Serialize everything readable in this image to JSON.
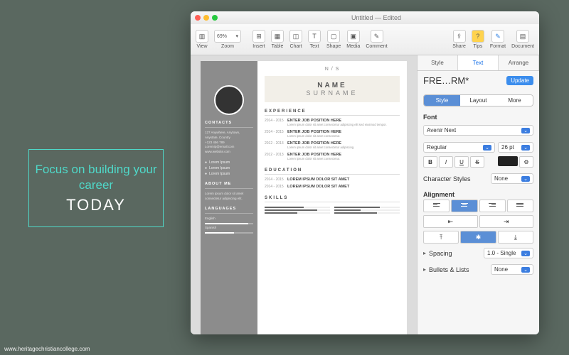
{
  "promo": {
    "line1": "Focus on building your career",
    "line2": "TODAY"
  },
  "watermark": "www.heritagechristiancollege.com",
  "window": {
    "title": "Untitled — Edited"
  },
  "toolbar": {
    "view": "View",
    "zoom": "Zoom",
    "zoom_value": "69%",
    "insert": "Insert",
    "table": "Table",
    "chart": "Chart",
    "text": "Text",
    "shape": "Shape",
    "media": "Media",
    "comment": "Comment",
    "share": "Share",
    "tips": "Tips",
    "format": "Format",
    "document": "Document"
  },
  "inspector": {
    "tabs": {
      "style": "Style",
      "text": "Text",
      "arrange": "Arrange"
    },
    "style_name": "FRE…RM*",
    "update": "Update",
    "seg": {
      "style": "Style",
      "layout": "Layout",
      "more": "More"
    },
    "font_label": "Font",
    "font_family": "Avenir Next",
    "font_style": "Regular",
    "font_size": "26 pt",
    "char_styles": "Character Styles",
    "char_value": "None",
    "alignment": "Alignment",
    "spacing": "Spacing",
    "spacing_value": "1.0 - Single",
    "bullets": "Bullets & Lists",
    "bullets_value": "None",
    "fmt": {
      "b": "B",
      "i": "I",
      "u": "U",
      "s": "S"
    }
  },
  "resume": {
    "monogram": "N / S",
    "name": "NAME",
    "surname": "SURNAME",
    "contacts_h": "CONTACTS",
    "contacts": [
      "127 Anywhere, Anytown,",
      "Anystate, Country",
      "+123 456 789",
      "Loremip@email.com",
      "www.website.com"
    ],
    "social": [
      "Lorem Ipsum",
      "Lorem Ipsum",
      "Lorem Ipsum"
    ],
    "about_h": "ABOUT ME",
    "about": "Lorem ipsum dolor sit amet consectetur adipiscing elit.",
    "languages_h": "LANGUAGES",
    "languages": [
      {
        "name": "English",
        "pct": 90
      },
      {
        "name": "Spanish",
        "pct": 60
      }
    ],
    "exp_h": "EXPERIENCE",
    "jobs": [
      {
        "years": "2014 - 2015",
        "title": "ENTER JOB POSITION HERE",
        "body": "Lorem ipsum dolor sit amet consectetur adipiscing elit sed eiusmod tempor."
      },
      {
        "years": "2014 - 2015",
        "title": "ENTER JOB POSITION HERE",
        "body": "Lorem ipsum dolor sit amet consectetur."
      },
      {
        "years": "2012 - 2013",
        "title": "ENTER JOB POSITION HERE",
        "body": "Lorem ipsum dolor sit amet consectetur adipiscing."
      },
      {
        "years": "2012 - 2013",
        "title": "ENTER JOB POSITION HERE",
        "body": "Lorem ipsum dolor sit amet consectetur."
      }
    ],
    "edu_h": "EDUCATION",
    "edu": [
      {
        "years": "2014 - 2015",
        "title": "LOREM IPSUM DOLOR SIT AMET"
      },
      {
        "years": "2014 - 2015",
        "title": "LOREM IPSUM DOLOR SIT AMET"
      }
    ],
    "skills_h": "SKILLS",
    "skills": [
      60,
      80,
      50,
      70,
      40,
      65
    ]
  }
}
